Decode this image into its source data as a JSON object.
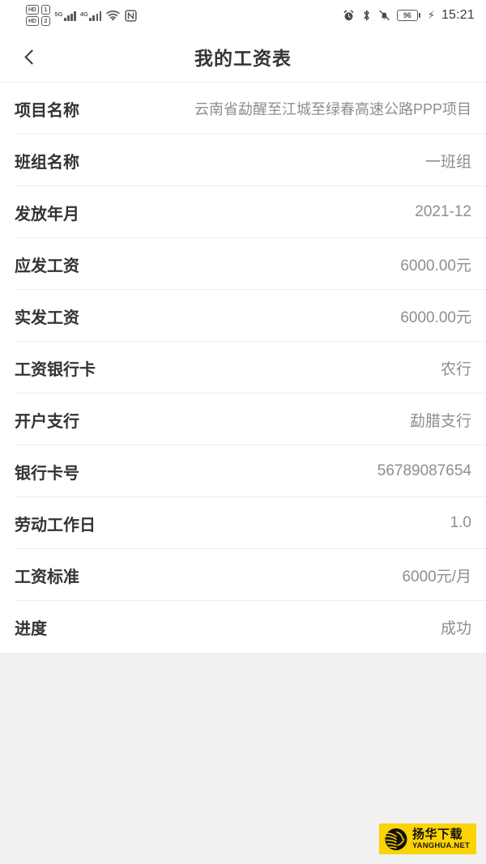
{
  "status_bar": {
    "hd_label_1": "HD",
    "hd_label_2": "HD",
    "sim_1": "1",
    "sim_2": "2",
    "network_1": "5G",
    "network_2": "4G",
    "wifi_icon": "wifi-icon",
    "nfc_icon": "nfc-icon",
    "alarm_icon": "alarm-icon",
    "bluetooth_icon": "bluetooth-icon",
    "mute_icon": "mute-bell-icon",
    "battery_percent": "96",
    "charging_icon": "charging-bolt-icon",
    "time": "15:21"
  },
  "navbar": {
    "back_icon": "chevron-left-icon",
    "title": "我的工资表"
  },
  "list": {
    "rows": [
      {
        "label": "项目名称",
        "value": "云南省勐醒至江城至绿春高速公路PPP项目"
      },
      {
        "label": "班组名称",
        "value": "一班组"
      },
      {
        "label": "发放年月",
        "value": "2021-12"
      },
      {
        "label": "应发工资",
        "value": "6000.00元"
      },
      {
        "label": "实发工资",
        "value": "6000.00元"
      },
      {
        "label": "工资银行卡",
        "value": "农行"
      },
      {
        "label": "开户支行",
        "value": "勐腊支行"
      },
      {
        "label": "银行卡号",
        "value": "56789087654"
      },
      {
        "label": "劳动工作日",
        "value": "1.0"
      },
      {
        "label": "工资标准",
        "value": "6000元/月"
      },
      {
        "label": "进度",
        "value": "成功"
      }
    ]
  },
  "watermark": {
    "logo_icon": "lion-head-logo-icon",
    "text_cn": "扬华下载",
    "text_en": "YANGHUA.NET",
    "background_color": "#fcd303"
  },
  "colors": {
    "page_background": "#f1f1f1",
    "surface": "#ffffff",
    "label_text": "#333333",
    "value_text": "#8e8e8e",
    "divider": "#ededed"
  }
}
